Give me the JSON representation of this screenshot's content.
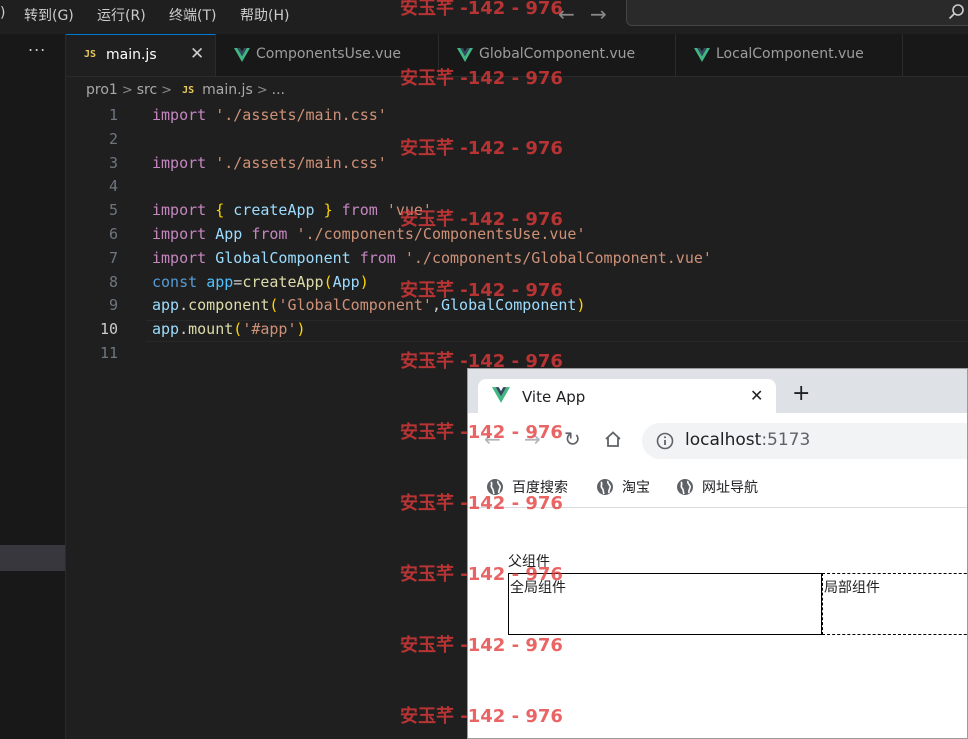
{
  "menubar": {
    "items": [
      ")",
      "转到(G)",
      "运行(R)",
      "终端(T)",
      "帮助(H)"
    ],
    "back_arrow": "←",
    "forward_arrow": "→"
  },
  "sidebar": {
    "more": "..."
  },
  "tabs": [
    {
      "label": "main.js",
      "icon": "js-icon",
      "active": true,
      "close": "✕"
    },
    {
      "label": "ComponentsUse.vue",
      "icon": "vue-icon"
    },
    {
      "label": "GlobalComponent.vue",
      "icon": "vue-icon"
    },
    {
      "label": "LocalComponent.vue",
      "icon": "vue-icon"
    }
  ],
  "breadcrumb": {
    "parts": [
      "pro1",
      "src",
      "main.js",
      "..."
    ],
    "js_badge": "JS"
  },
  "editor": {
    "line_numbers": [
      "1",
      "2",
      "3",
      "4",
      "5",
      "6",
      "7",
      "8",
      "9",
      "10",
      "11"
    ],
    "current_line": 10,
    "tokens": {
      "import": "import",
      "from": "from",
      "const": "const",
      "main_css": "'./assets/main.css'",
      "lb": "{",
      "rb": "}",
      "createApp": "createApp",
      "vue": "'vue'",
      "App": "App",
      "componentsuse_path": "'./components/ComponentsUse.vue'",
      "GlobalComponent": "GlobalComponent",
      "global_path": "'./components/GlobalComponent.vue'",
      "app": "app",
      "eq": "=",
      "lp": "(",
      "rp": ")",
      "dot": ".",
      "component": "component",
      "global_name": "'GlobalComponent'",
      "comma": ",",
      "mount": "mount",
      "app_selector": "'#app'"
    }
  },
  "browser": {
    "tab_title": "Vite App",
    "tab_close": "✕",
    "new_tab": "+",
    "back": "←",
    "forward": "→",
    "reload": "↻",
    "url_host": "localhost",
    "url_port": ":5173",
    "bookmarks": [
      "百度搜索",
      "淘宝",
      "网址导航"
    ],
    "page": {
      "parent_label": "父组件",
      "global_label": "全局组件",
      "local_label": "局部组件"
    }
  },
  "watermark": {
    "text": "安玉芊 -142 - 976"
  },
  "colors": {
    "accent": "#0078d4",
    "vue_green": "#41b883",
    "watermark": "#e33a3a"
  }
}
